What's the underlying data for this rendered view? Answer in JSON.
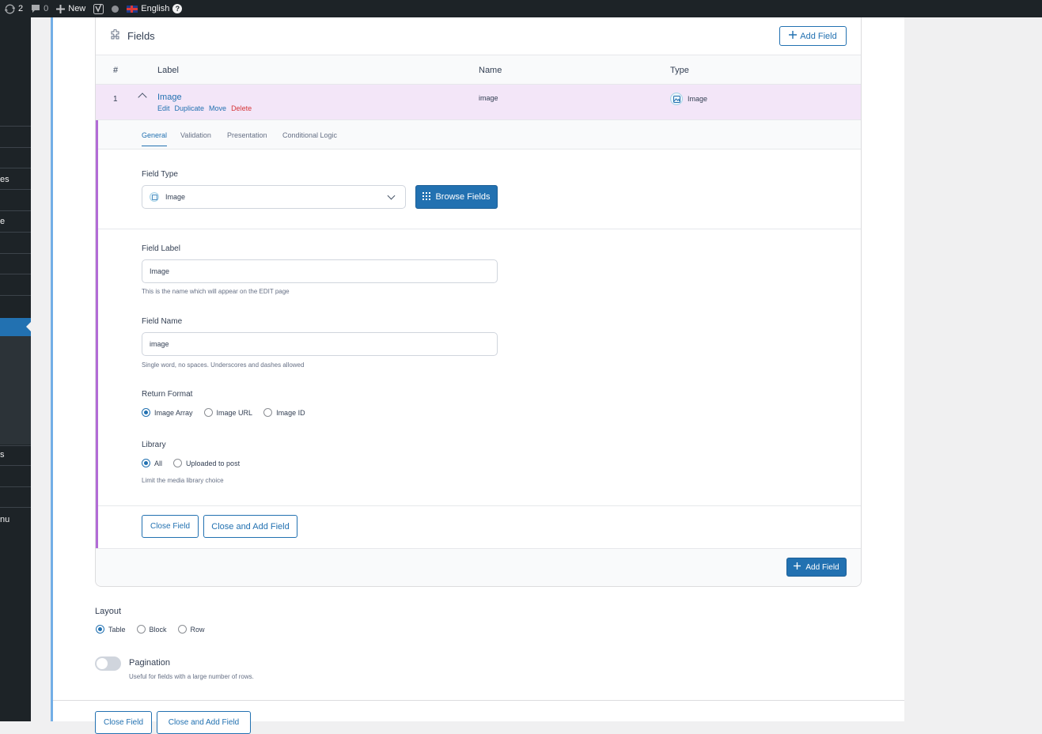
{
  "adminbar": {
    "updates_count": "2",
    "comments_count": "0",
    "new_label": "New",
    "language_label": "English",
    "help_label": "?"
  },
  "sidemenu": {
    "fragments": [
      "es",
      "e",
      "s",
      "nu"
    ]
  },
  "fields_box": {
    "title": "Fields",
    "add_field_label": "Add Field",
    "columns": {
      "num": "#",
      "label": "Label",
      "name": "Name",
      "type": "Type"
    },
    "row": {
      "num": "1",
      "label": "Image",
      "actions": {
        "edit": "Edit",
        "duplicate": "Duplicate",
        "move": "Move",
        "delete": "Delete"
      },
      "name": "image",
      "type": "Image"
    },
    "tabs": [
      "General",
      "Validation",
      "Presentation",
      "Conditional Logic"
    ],
    "active_tab": "General",
    "field_type": {
      "label": "Field Type",
      "value": "Image",
      "browse_label": "Browse Fields"
    },
    "field_label": {
      "label": "Field Label",
      "value": "Image",
      "hint": "This is the name which will appear on the EDIT page"
    },
    "field_name": {
      "label": "Field Name",
      "value": "image",
      "hint": "Single word, no spaces. Underscores and dashes allowed"
    },
    "return_format": {
      "label": "Return Format",
      "options": [
        "Image Array",
        "Image URL",
        "Image ID"
      ],
      "selected": "Image Array"
    },
    "library": {
      "label": "Library",
      "options": [
        "All",
        "Uploaded to post"
      ],
      "selected": "All",
      "hint": "Limit the media library choice"
    },
    "close_field_label": "Close Field",
    "close_and_add_label": "Close and Add Field",
    "footer_add_label": "Add Field"
  },
  "layout": {
    "label": "Layout",
    "options": [
      "Table",
      "Block",
      "Row"
    ],
    "selected": "Table"
  },
  "pagination": {
    "label": "Pagination",
    "hint": "Useful for fields with a large number of rows.",
    "enabled": false
  },
  "bottom_buttons": {
    "close_field_label": "Close Field",
    "close_and_add_label": "Close and Add Field"
  },
  "colors": {
    "accent": "#2271b1",
    "row_highlight": "#f3e6f8",
    "settings_border": "#b26bd6",
    "admin_bg": "#1d2327"
  }
}
